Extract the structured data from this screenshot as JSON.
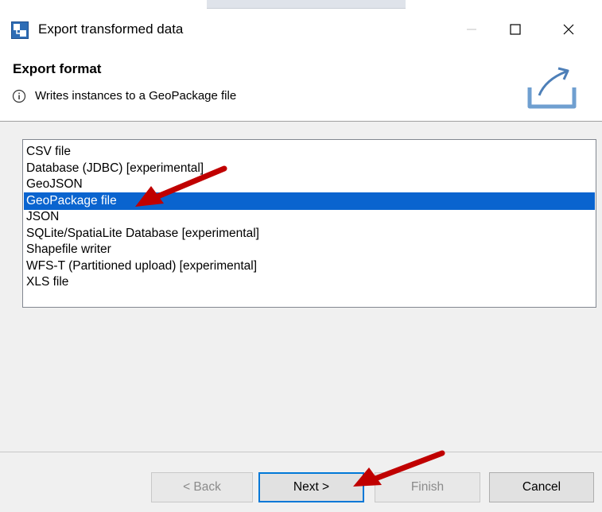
{
  "window": {
    "title": "Export transformed data"
  },
  "header": {
    "title": "Export format",
    "message": "Writes instances to a GeoPackage file"
  },
  "formats": {
    "items": [
      "CSV file",
      "Database (JDBC) [experimental]",
      "GeoJSON",
      "GeoPackage file",
      "JSON",
      "SQLite/SpatiaLite Database [experimental]",
      "Shapefile writer",
      "WFS-T (Partitioned upload) [experimental]",
      "XLS file"
    ],
    "selected": "GeoPackage file"
  },
  "buttons": {
    "back": "< Back",
    "next": "Next >",
    "finish": "Finish",
    "cancel": "Cancel"
  },
  "icons": {
    "window_icon": "export-app-icon",
    "info": "info-icon",
    "export_banner": "export-tray-icon",
    "annotations": "red-arrow-icon"
  },
  "colors": {
    "selection": "#0a64cf",
    "annotation_arrow": "#c00000",
    "dialog_bg": "#f0f0f0",
    "accent_border": "#0078d7"
  }
}
